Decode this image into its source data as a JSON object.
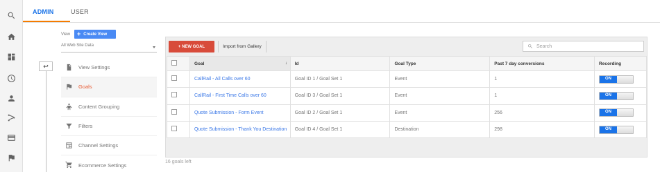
{
  "tabs": {
    "admin": "ADMIN",
    "user": "USER"
  },
  "view": {
    "label": "View",
    "create_view": "Create View",
    "selected": "All Web Site Data"
  },
  "nav": [
    {
      "label": "View Settings",
      "icon": "document-icon"
    },
    {
      "label": "Goals",
      "icon": "flag-icon",
      "active": true
    },
    {
      "label": "Content Grouping",
      "icon": "person-group-icon"
    },
    {
      "label": "Filters",
      "icon": "filter-icon"
    },
    {
      "label": "Channel Settings",
      "icon": "channel-icon"
    },
    {
      "label": "Ecommerce Settings",
      "icon": "cart-icon"
    }
  ],
  "toolbar": {
    "new_goal": "+ NEW GOAL",
    "import": "Import from Gallery",
    "search_placeholder": "Search"
  },
  "table": {
    "headers": [
      "Goal",
      "Id",
      "Goal Type",
      "Past 7 day conversions",
      "Recording"
    ],
    "rows": [
      {
        "goal": "CallRail - All Calls over 60",
        "id": "Goal ID 1 / Goal Set 1",
        "type": "Event",
        "conversions": "1",
        "recording": "ON"
      },
      {
        "goal": "CallRail - First Time Calls over 60",
        "id": "Goal ID 3 / Goal Set 1",
        "type": "Event",
        "conversions": "1",
        "recording": "ON"
      },
      {
        "goal": "Quote Submission - Form Event",
        "id": "Goal ID 2 / Goal Set 1",
        "type": "Event",
        "conversions": "256",
        "recording": "ON"
      },
      {
        "goal": "Quote Submission - Thank You Destination",
        "id": "Goal ID 4 / Goal Set 1",
        "type": "Destination",
        "conversions": "298",
        "recording": "ON"
      }
    ]
  },
  "footer": {
    "goals_left": "16 goals left"
  },
  "colors": {
    "accent": "#1a73e8",
    "new_goal": "#d84b3a",
    "tab_underline": "#f57c00",
    "active_nav": "#e8572f"
  }
}
